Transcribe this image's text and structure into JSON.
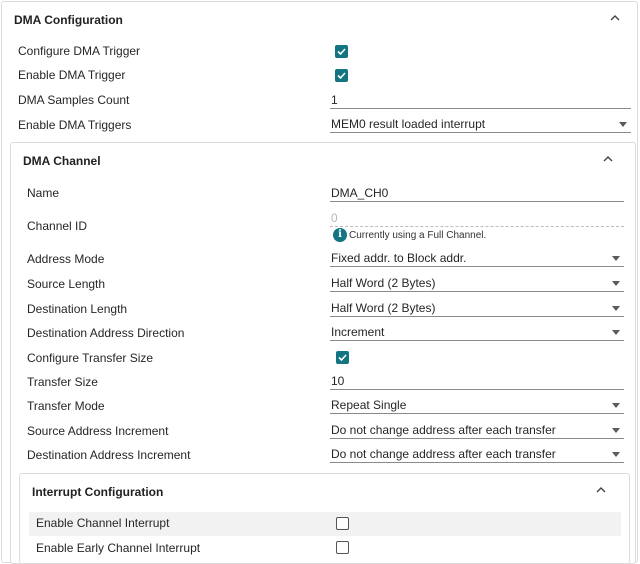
{
  "dma_config": {
    "title": "DMA Configuration",
    "configure_trigger_label": "Configure DMA Trigger",
    "configure_trigger_checked": true,
    "enable_trigger_label": "Enable DMA Trigger",
    "enable_trigger_checked": true,
    "samples_count_label": "DMA Samples Count",
    "samples_count_value": "1",
    "enable_triggers_label": "Enable DMA Triggers",
    "enable_triggers_value": "MEM0 result loaded interrupt"
  },
  "dma_channel": {
    "title": "DMA Channel",
    "name_label": "Name",
    "name_value": "DMA_CH0",
    "channel_id_label": "Channel ID",
    "channel_id_value": "0",
    "channel_id_hint": "Currently using a Full Channel.",
    "info_glyph": "i",
    "address_mode_label": "Address Mode",
    "address_mode_value": "Fixed addr. to Block addr.",
    "source_length_label": "Source Length",
    "source_length_value": "Half Word (2 Bytes)",
    "dest_length_label": "Destination Length",
    "dest_length_value": "Half Word (2 Bytes)",
    "dest_addr_dir_label": "Destination Address Direction",
    "dest_addr_dir_value": "Increment",
    "configure_transfer_size_label": "Configure Transfer Size",
    "configure_transfer_size_checked": true,
    "transfer_size_label": "Transfer Size",
    "transfer_size_value": "10",
    "transfer_mode_label": "Transfer Mode",
    "transfer_mode_value": "Repeat Single",
    "source_addr_inc_label": "Source Address Increment",
    "source_addr_inc_value": "Do not change address after each transfer",
    "dest_addr_inc_label": "Destination Address Increment",
    "dest_addr_inc_value": "Do not change address after each transfer"
  },
  "interrupt_config": {
    "title": "Interrupt Configuration",
    "enable_channel_int_label": "Enable Channel Interrupt",
    "enable_channel_int_checked": false,
    "enable_early_channel_int_label": "Enable Early Channel Interrupt",
    "enable_early_channel_int_checked": false
  },
  "colors": {
    "accent": "#137581",
    "border": "#dcdcdc",
    "highlight_row": "#f2f2f2"
  },
  "icons": {
    "collapse": "chevron-up-icon",
    "dropdown": "caret-down-icon",
    "info": "info-icon"
  }
}
